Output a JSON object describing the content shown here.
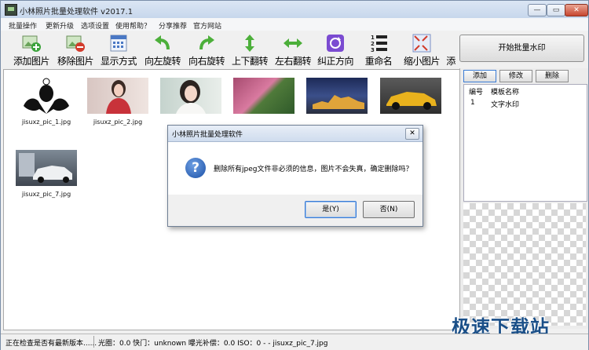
{
  "window": {
    "title": "小林照片批量处理软件 v2017.1",
    "controls": {
      "minimize": "—",
      "restore": "▭",
      "close": "✕"
    }
  },
  "menu": [
    "批量操作",
    "更新升级",
    "选项设置",
    "使用帮助？",
    "分享推荐",
    "官方网站"
  ],
  "toolbar": [
    {
      "label": "添加图片",
      "icon": "add-image-icon"
    },
    {
      "label": "移除图片",
      "icon": "remove-image-icon"
    },
    {
      "label": "显示方式",
      "icon": "display-mode-icon"
    },
    {
      "label": "向左旋转",
      "icon": "rotate-left-icon"
    },
    {
      "label": "向右旋转",
      "icon": "rotate-right-icon"
    },
    {
      "label": "上下翻转",
      "icon": "flip-vertical-icon"
    },
    {
      "label": "左右翻转",
      "icon": "flip-horizontal-icon"
    },
    {
      "label": "纠正方向",
      "icon": "correct-orientation-icon"
    },
    {
      "label": "重命名",
      "icon": "rename-icon"
    },
    {
      "label": "缩小图片",
      "icon": "shrink-image-icon"
    },
    {
      "label": "添",
      "icon": "cut-off-icon"
    }
  ],
  "right_panel": {
    "start_button": "开始批量水印",
    "buttons": [
      "添加",
      "修改",
      "删除"
    ],
    "list_headers": [
      "编号",
      "模板名称"
    ],
    "rows": [
      {
        "id": "1",
        "name": "文字水印"
      }
    ]
  },
  "thumbnails": [
    {
      "caption": "jisuxz_pic_1.jpg",
      "kind": "avatar"
    },
    {
      "caption": "jisuxz_pic_2.jpg",
      "kind": "portrait-red"
    },
    {
      "caption": "",
      "kind": "portrait-white"
    },
    {
      "caption": "",
      "kind": "flowers"
    },
    {
      "caption": "",
      "kind": "night-city"
    },
    {
      "caption": "",
      "kind": "yellow-car"
    },
    {
      "caption": "jisuxz_pic_7.jpg",
      "kind": "white-car"
    }
  ],
  "dialog": {
    "title": "小林照片批量处理软件",
    "close": "✕",
    "icon": "question-icon",
    "message": "删除所有jpeg文件非必须的信息，图片不会失真，确定删除吗？",
    "yes_label": "是(Y)",
    "no_label": "否(N)"
  },
  "status": {
    "left": "正在检查是否有最新版本......",
    "right": "光圈：0.0 快门：unknown 曝光补偿：0.0 ISO：0 -  - jisuxz_pic_7.jpg"
  },
  "site_watermark": "极速下载站",
  "colors": {
    "accent_blue": "#1a4fa6",
    "add_green": "#3aa33a",
    "remove_red": "#d23b2b",
    "arrow_green": "#4caf3a",
    "flip_purple": "#7b4bd1"
  }
}
